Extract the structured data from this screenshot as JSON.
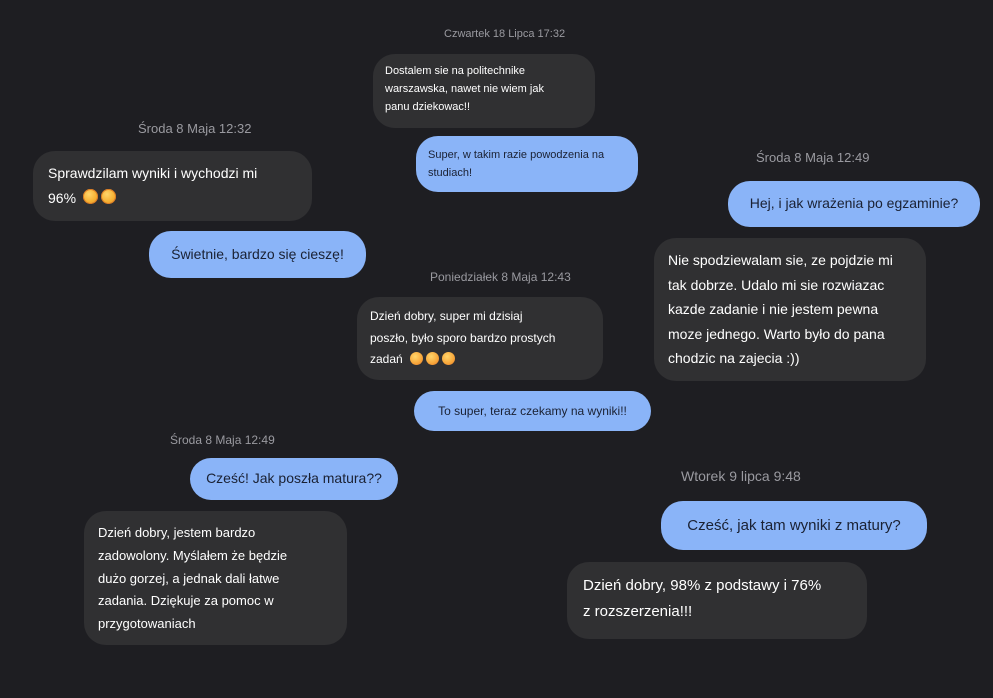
{
  "conversations": [
    {
      "timestamp": "Czwartek 18 Lipca 17:32",
      "incoming": [
        "Dostalem sie na politechnike",
        "warszawska, nawet nie wiem jak",
        "panu dziekowac!!"
      ],
      "outgoing": [
        "Super, w takim razie powodzenia na",
        "studiach!"
      ]
    },
    {
      "timestamp": "Środa 8 Maja 12:32",
      "incoming": [
        "Sprawdzilam wyniki i wychodzi mi",
        "96%"
      ],
      "incoming_emojis": [
        "smiling-face-with-hearts-icon",
        "smiling-face-with-hearts-icon"
      ],
      "outgoing": "Świetnie, bardzo się cieszę!"
    },
    {
      "timestamp": "Środa 8 Maja 12:49",
      "outgoing": "Hej, i jak wrażenia po egzaminie?",
      "incoming": [
        "Nie spodziewalam sie, ze pojdzie mi",
        "tak dobrze. Udalo mi sie rozwiazac",
        "kazde zadanie i nie jestem pewna",
        "moze jednego. Warto było do pana",
        "chodzic na zajecia :))"
      ]
    },
    {
      "timestamp": "Poniedziałek 8 Maja 12:43",
      "incoming": [
        "Dzień dobry, super mi dzisiaj",
        "poszło, było sporo bardzo prostych",
        "zadań"
      ],
      "incoming_emojis": [
        "smiling-face-icon",
        "smiling-face-icon",
        "smiling-face-icon"
      ],
      "outgoing": "To super, teraz czekamy na wyniki!!"
    },
    {
      "timestamp": "Środa 8 Maja 12:49",
      "outgoing": "Cześć! Jak poszła matura??",
      "incoming": [
        "Dzień dobry, jestem bardzo",
        "zadowolony. Myślałem że będzie",
        "dużo gorzej, a jednak dali łatwe",
        "zadania. Dziękuje za pomoc w",
        "przygotowaniach"
      ]
    },
    {
      "timestamp": "Wtorek 9 lipca 9:48",
      "outgoing": "Cześć, jak tam wyniki z matury?",
      "incoming": [
        "Dzień dobry, 98% z podstawy i 76%",
        "z rozszerzenia!!!"
      ]
    }
  ],
  "colors": {
    "background": "#1e1e22",
    "incoming_bubble": "#303032",
    "outgoing_bubble": "#8ab4f8",
    "timestamp_text": "#9a9aa0"
  }
}
